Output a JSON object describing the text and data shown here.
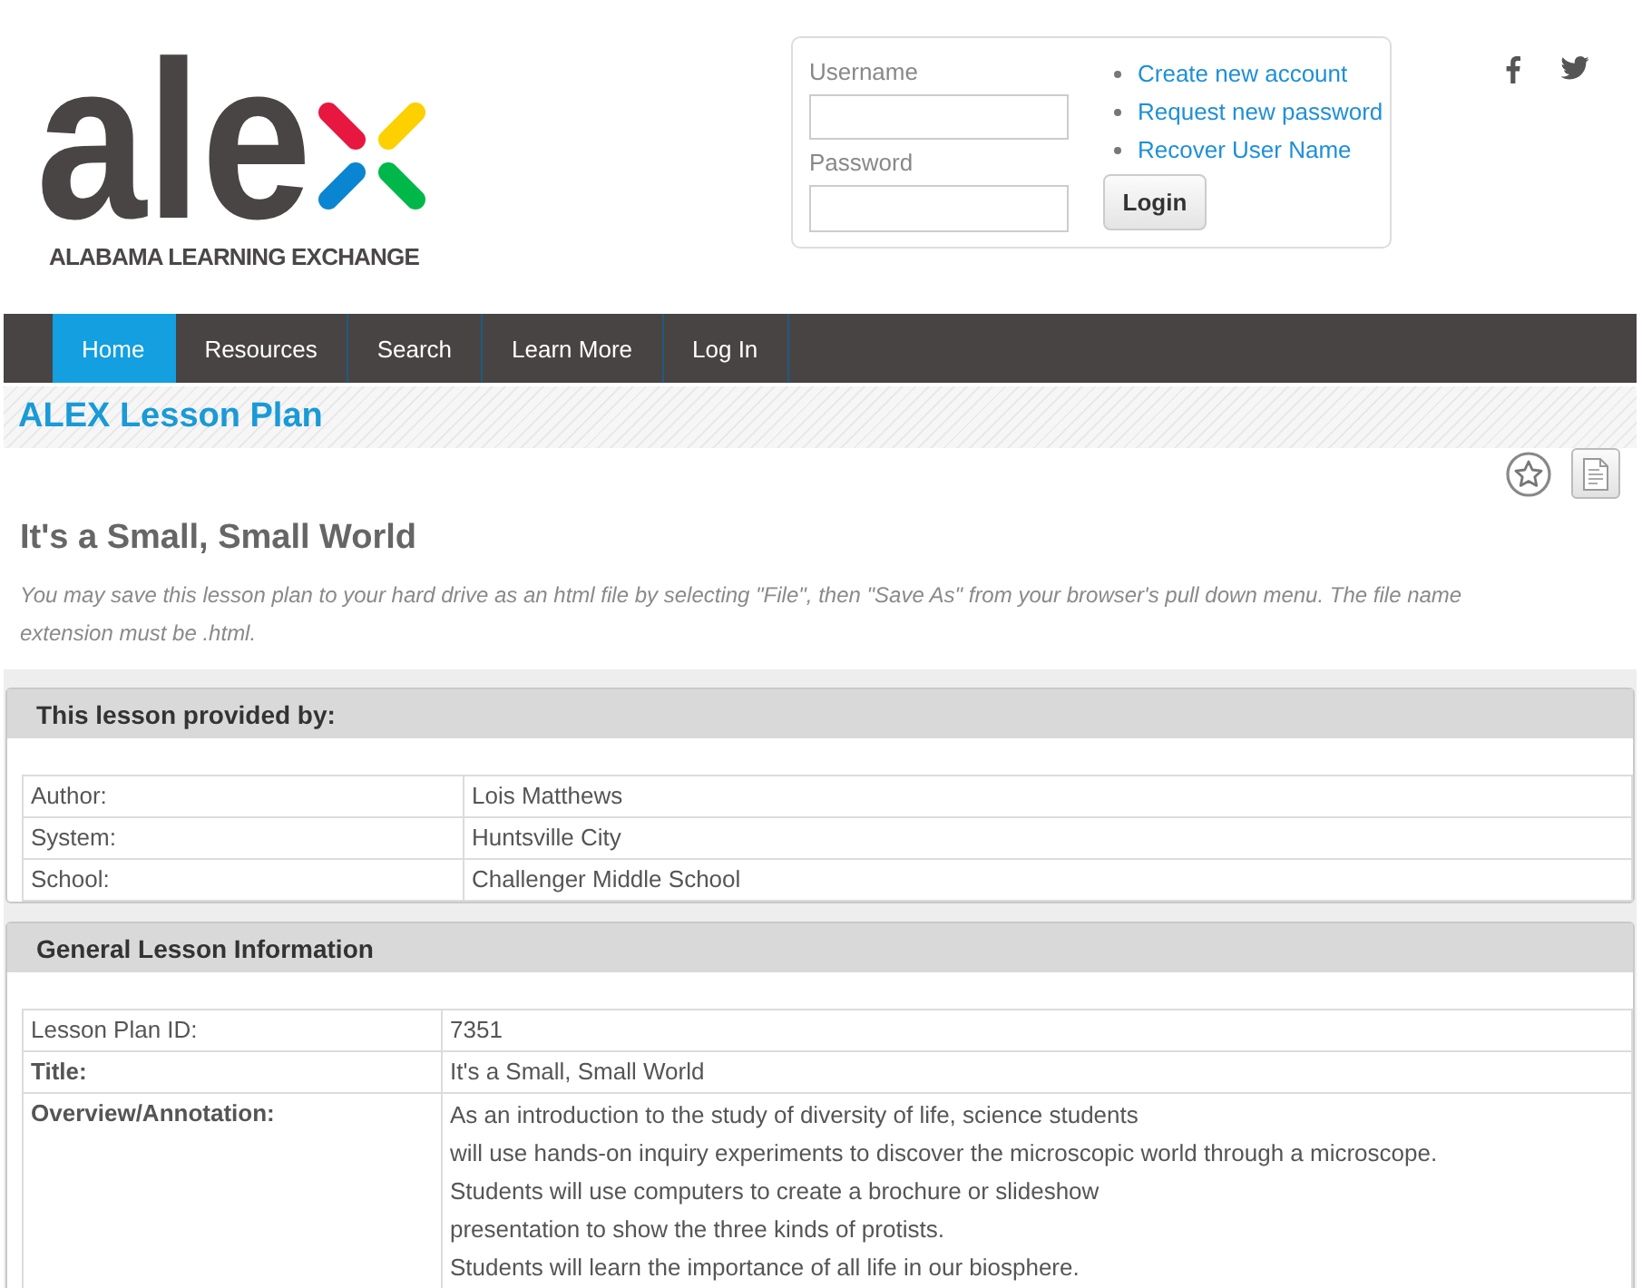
{
  "logo": {
    "wordmark": "ale",
    "tagline": "ALABAMA LEARNING EXCHANGE"
  },
  "login": {
    "fields": [
      {
        "label": "Username"
      },
      {
        "label": "Password"
      }
    ],
    "links": [
      "Create new account",
      "Request new password",
      "Recover User Name"
    ],
    "button": "Login"
  },
  "nav": [
    {
      "label": "Home",
      "selected": true
    },
    {
      "label": "Resources",
      "selected": false
    },
    {
      "label": "Search",
      "selected": false
    },
    {
      "label": "Learn More",
      "selected": false
    },
    {
      "label": "Log In",
      "selected": false
    }
  ],
  "banner": {
    "title": "ALEX Lesson Plan"
  },
  "lesson": {
    "title": "It's a Small, Small World",
    "note": "You may save this lesson plan to your hard drive as an html file by selecting \"File\", then \"Save As\" from your browser's pull down menu. The file name extension must be .html."
  },
  "sections": [
    {
      "heading": "This lesson provided by:",
      "rows": [
        {
          "label": "Author:",
          "value": "Lois Matthews",
          "label_bold": false
        },
        {
          "label": "System:",
          "value": "Huntsville City",
          "label_bold": false
        },
        {
          "label": "School:",
          "value": "Challenger Middle School",
          "label_bold": false
        }
      ]
    },
    {
      "heading": "General Lesson Information",
      "rows": [
        {
          "label": "Lesson Plan ID:",
          "value": "7351",
          "label_bold": false
        },
        {
          "label": "Title:",
          "value": "It's a Small, Small World",
          "label_bold": true
        },
        {
          "label": "Overview/Annotation:",
          "value": "As an introduction to the study of diversity of life, science students\nwill use hands-on inquiry experiments to discover the microscopic world through a microscope.\nStudents will use computers to create a brochure or slideshow\npresentation to show the three kinds of protists.\nStudents will learn the importance of all life in our biosphere.",
          "label_bold": true
        }
      ]
    }
  ]
}
